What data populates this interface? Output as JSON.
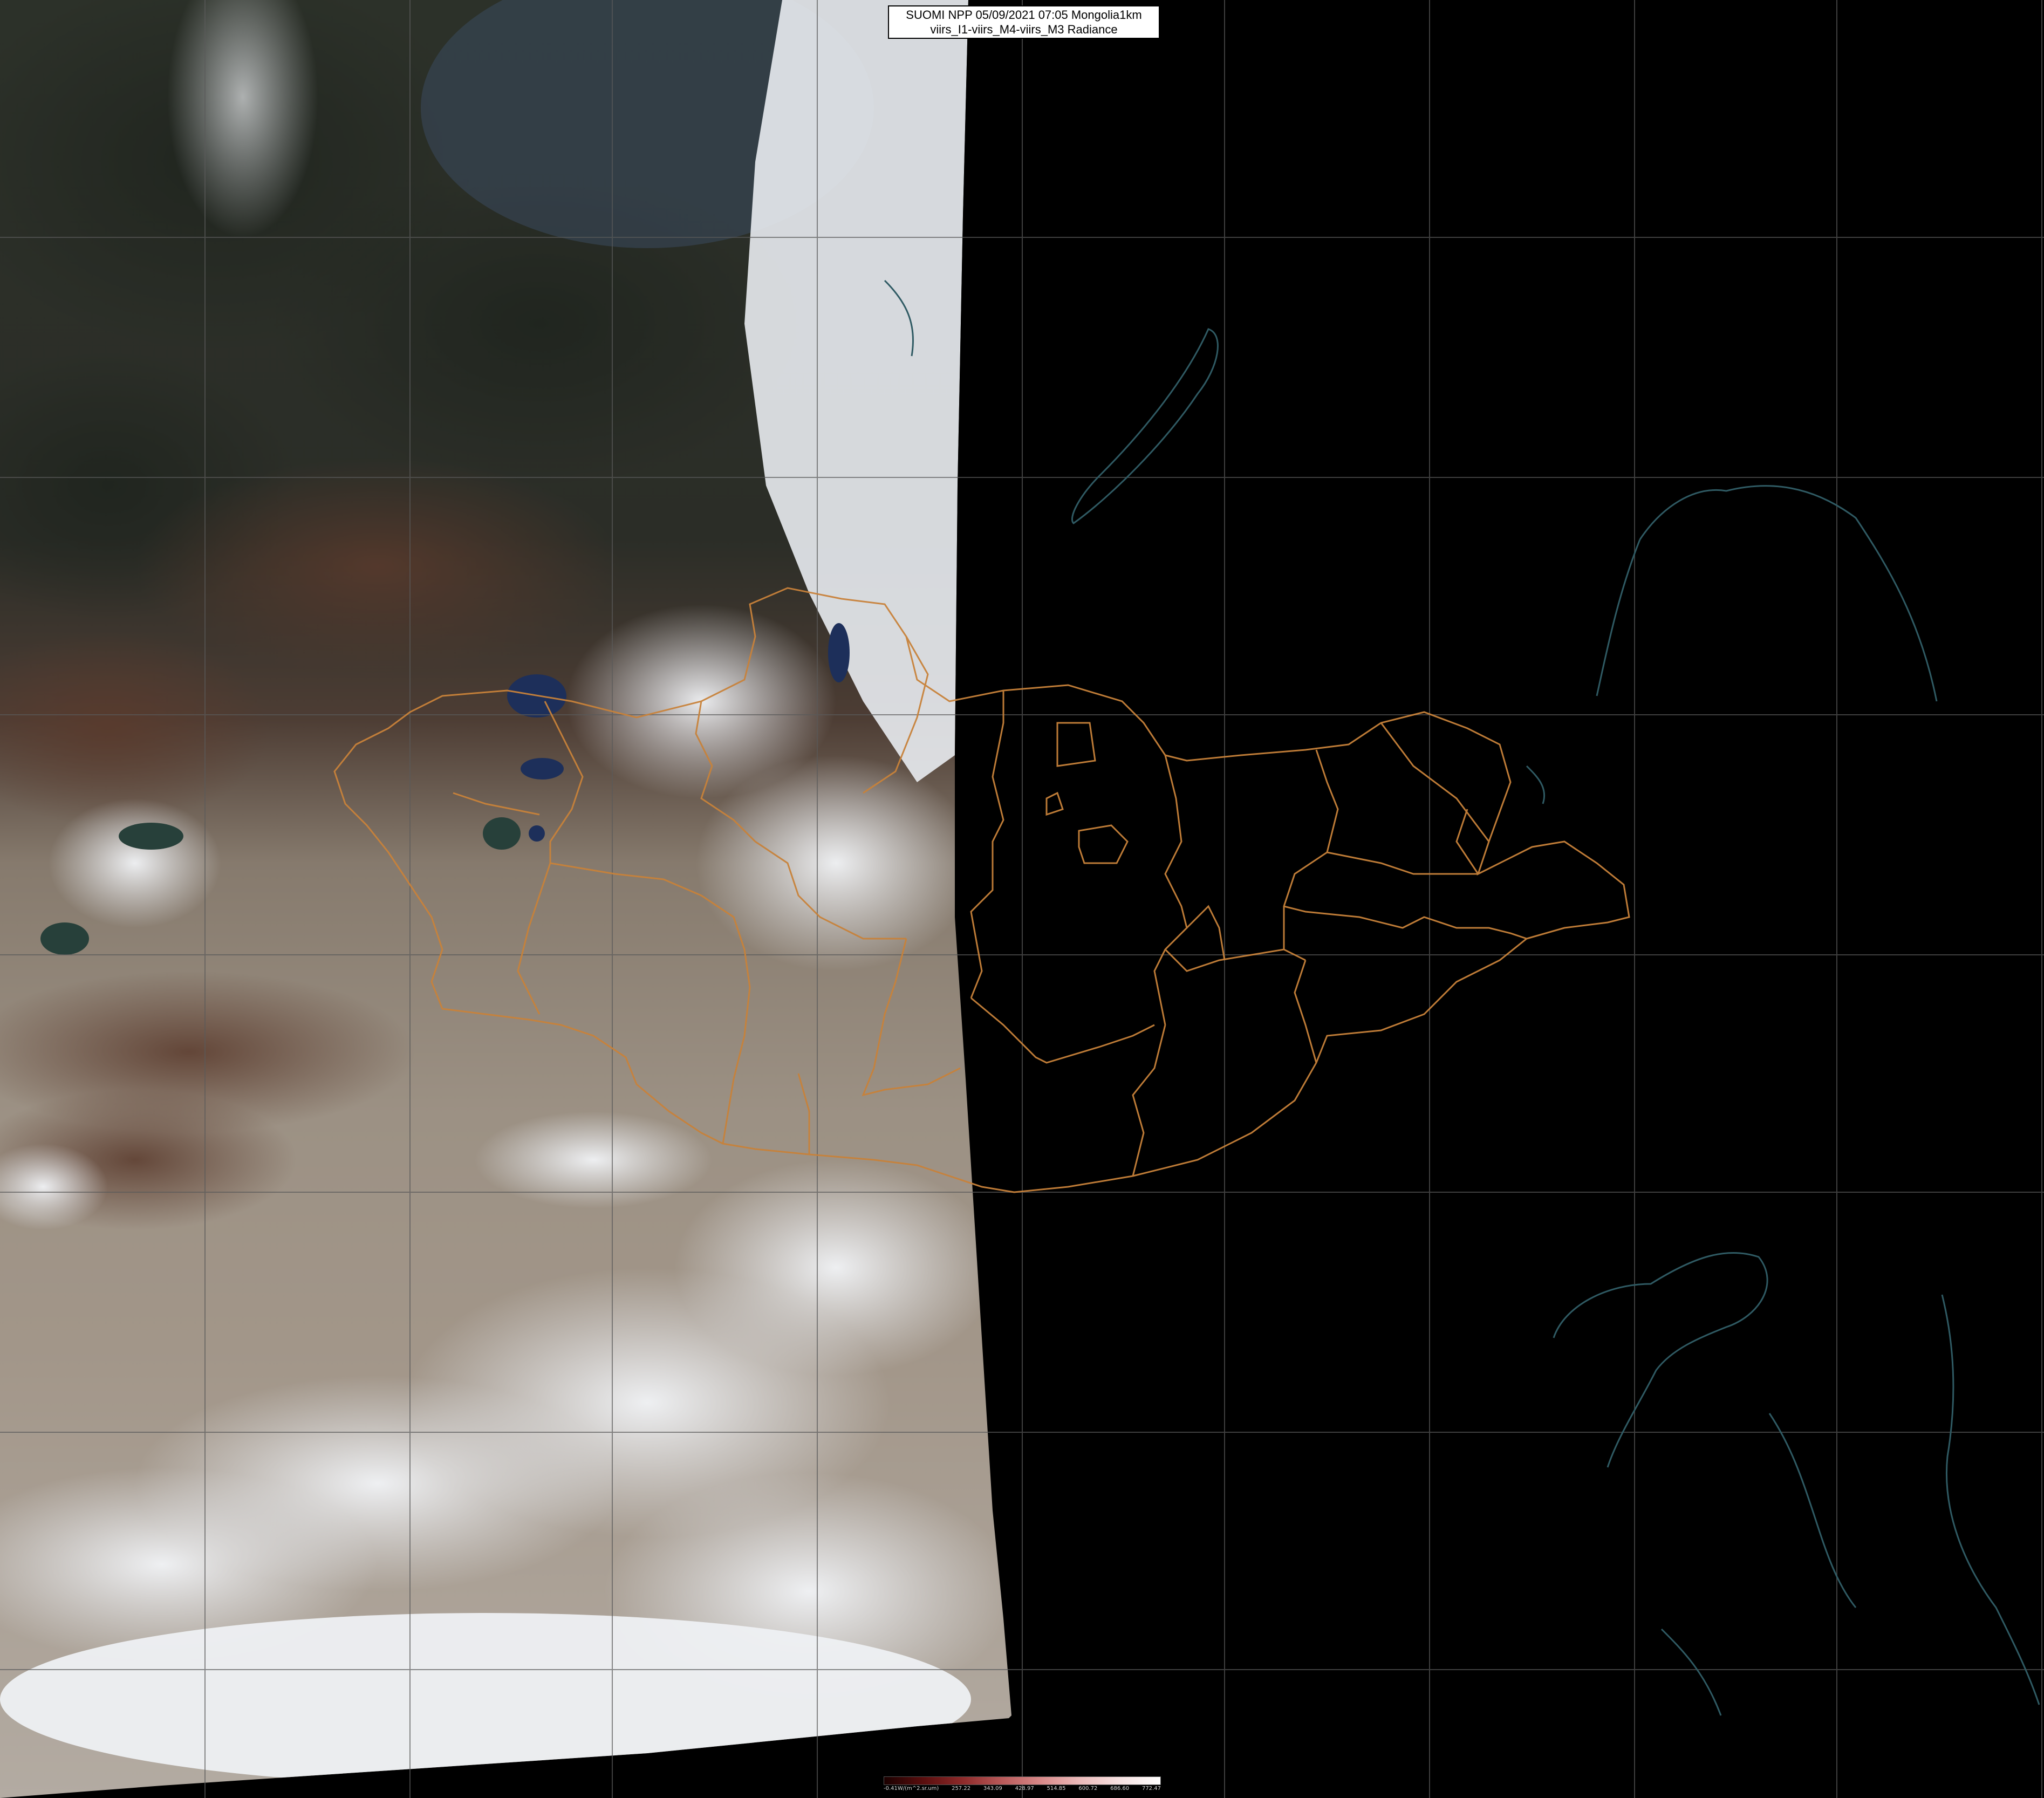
{
  "title": {
    "line1": "SUOMI NPP 05/09/2021 07:05 Mongolia1km",
    "line2": "viirs_I1-viirs_M4-viirs_M3 Radiance"
  },
  "colorbar": {
    "unit_label": "-0.41W/(m^2.sr.um)",
    "ticks": [
      "257.22",
      "343.09",
      "428.97",
      "514.85",
      "600.72",
      "686.60",
      "772.47"
    ],
    "colors": [
      "#1a0000",
      "#5a0e0e",
      "#8e2a2a",
      "#b95a5a",
      "#d98a8a",
      "#ecbcbc",
      "#f7e2e2",
      "#ffffff"
    ]
  },
  "image": {
    "description_colors": {
      "forest": "#2a2f26",
      "desert": "#9c9084",
      "snow_cloud": "#e8ecf0",
      "night": "#000000",
      "border_orange": "#c8823a",
      "coastline_teal": "#2f5a63",
      "graticule": "#5a5a5a",
      "lake": "#1a2a55"
    }
  }
}
